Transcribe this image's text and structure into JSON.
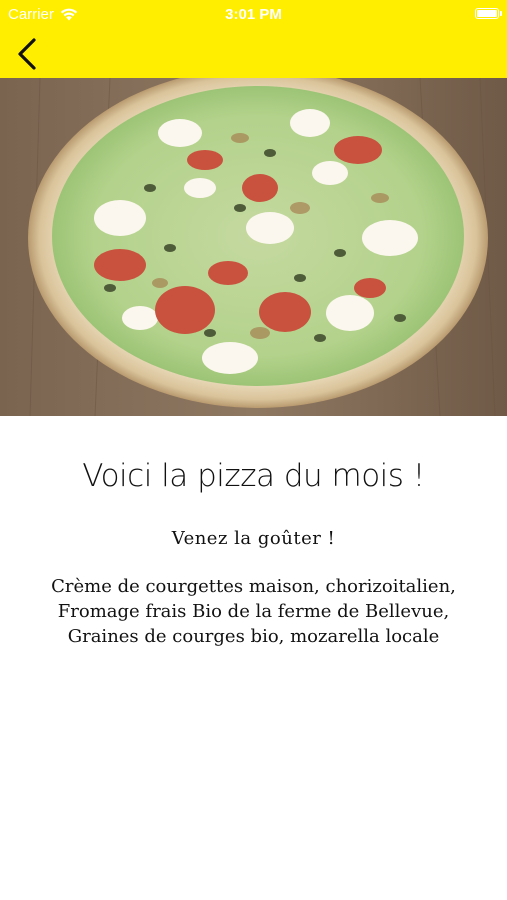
{
  "status_bar": {
    "carrier": "Carrier",
    "time": "3:01 PM",
    "wifi_icon": "wifi-icon",
    "battery_icon": "battery-icon"
  },
  "nav": {
    "back_icon": "chevron-left-icon",
    "background": "#ffee00"
  },
  "hero_image": "pizza-photo",
  "content": {
    "title": "Voici la pizza du mois !",
    "subtitle": "Venez la goûter !",
    "description_lines": [
      "Crème de courgettes maison, chorizoitalien,",
      "Fromage frais Bio de la ferme de Bellevue,",
      "Graines de courges bio, mozarella locale"
    ]
  }
}
